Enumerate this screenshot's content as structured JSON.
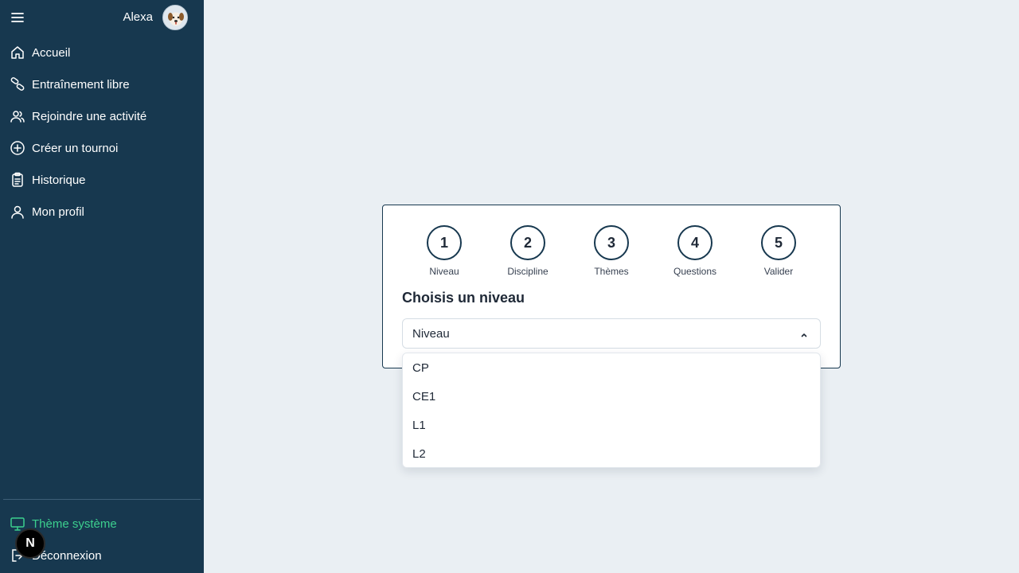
{
  "user": {
    "name": "Alexa",
    "avatar_icon": "dog-avatar-icon"
  },
  "sidebar": {
    "items": [
      {
        "label": "Accueil",
        "icon": "home-icon"
      },
      {
        "label": "Entraînement libre",
        "icon": "pills-icon"
      },
      {
        "label": "Rejoindre une activité",
        "icon": "users-icon"
      },
      {
        "label": "Créer un tournoi",
        "icon": "plus-circle-icon"
      },
      {
        "label": "Historique",
        "icon": "clipboard-icon"
      },
      {
        "label": "Mon profil",
        "icon": "user-icon"
      }
    ],
    "theme_label": "Thème système",
    "logout_label": "Déconnexion",
    "next_badge": "N"
  },
  "wizard": {
    "steps": [
      {
        "number": "1",
        "label": "Niveau"
      },
      {
        "number": "2",
        "label": "Discipline"
      },
      {
        "number": "3",
        "label": "Thèmes"
      },
      {
        "number": "4",
        "label": "Questions"
      },
      {
        "number": "5",
        "label": "Valider"
      }
    ],
    "title": "Choisis un niveau",
    "select_value": "Niveau",
    "options": [
      "CP",
      "CE1",
      "L1",
      "L2"
    ]
  },
  "colors": {
    "sidebar_bg": "#17384f",
    "page_bg": "#eaeff3",
    "accent_green": "#3ccf8e"
  }
}
